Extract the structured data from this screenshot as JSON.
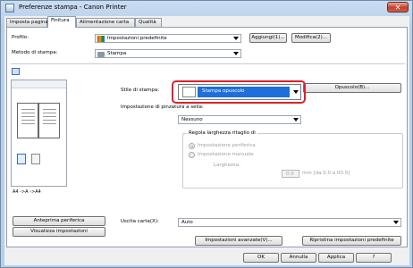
{
  "window": {
    "title": "Preferenze stampa - Canon Printer",
    "close_glyph": "✕"
  },
  "tabs": [
    "Imposta pagina",
    "Finitura",
    "Alimentazione carta",
    "Qualità"
  ],
  "profile": {
    "label": "Profilo:",
    "value": "Impostazioni predefinite",
    "add_label": "Aggiungi(1)...",
    "edit_label": "Modifica(2)..."
  },
  "method": {
    "label": "Metodo di stampa:",
    "value": "Stampa"
  },
  "preview": {
    "caption": "A4 ->A ->A4"
  },
  "print_style": {
    "label": "Stile di stampa:",
    "value": "Stampa opuscolo",
    "booklet_button": "Opuscolo(B)..."
  },
  "staple_section": {
    "label": "Impostazione di pinzatura a sella:",
    "value": "Nessuno",
    "group_title": "Regola larghezza ritaglio di",
    "radio_auto": "Impostazione periferica",
    "radio_manual": "Impostazione manuale",
    "width_label": "Larghezza:",
    "width_value": "0.0",
    "width_unit": "mm [da 0.0 a 00.0]"
  },
  "left_buttons": {
    "periphery": "Anteprima periferica",
    "view_settings": "Visualizza impostazioni"
  },
  "output": {
    "label": "Uscita carta(X):",
    "value": "Auto"
  },
  "advanced_button": "Impostazioni avanzate(V)...",
  "restore_button": "Ripristina impostazioni predefinite",
  "footer": {
    "ok": "OK",
    "cancel": "Annulla",
    "apply": "Applica",
    "help": "?"
  },
  "colors": {
    "accent_blue": "#1e6fd9",
    "highlight_red": "#e0202a"
  }
}
